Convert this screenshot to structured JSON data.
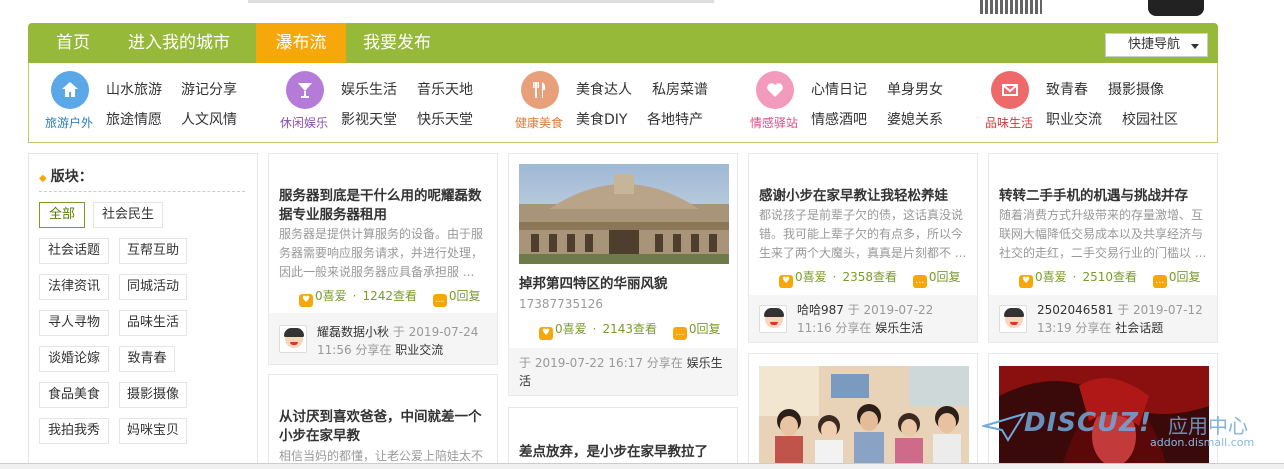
{
  "nav": {
    "items": [
      "首页",
      "进入我的城市",
      "瀑布流",
      "我要发布"
    ],
    "active_index": 2,
    "quick_nav": "快捷导航"
  },
  "categories": [
    {
      "name": "旅游户外",
      "icon": "home-icon",
      "color": "#5aa8e8",
      "name_color": "#2a7cc4",
      "links": [
        "山水旅游",
        "游记分享",
        "旅途情愿",
        "人文风情"
      ]
    },
    {
      "name": "休闲娱乐",
      "icon": "cocktail-icon",
      "color": "#b57bd9",
      "name_color": "#8b4fb3",
      "links": [
        "娱乐生活",
        "音乐天地",
        "影视天堂",
        "快乐天堂"
      ]
    },
    {
      "name": "健康美食",
      "icon": "fork-knife-icon",
      "color": "#e8a07a",
      "name_color": "#e07a3a",
      "links": [
        "美食达人",
        "私房菜谱",
        "美食DIY",
        "各地特产"
      ]
    },
    {
      "name": "情感驿站",
      "icon": "heart-icon",
      "color": "#f29bbd",
      "name_color": "#e04a8a",
      "links": [
        "心情日记",
        "单身男女",
        "情感酒吧",
        "婆媳关系"
      ]
    },
    {
      "name": "品味生活",
      "icon": "envelope-icon",
      "color": "#ee6a6a",
      "name_color": "#d13a3a",
      "links": [
        "致青春",
        "摄影摄像",
        "职业交流",
        "校园社区"
      ]
    }
  ],
  "sidebar": {
    "heading": "版块：",
    "tags": [
      "全部",
      "社会民生",
      "社会话题",
      "互帮互助",
      "法律资讯",
      "同城活动",
      "寻人寻物",
      "品味生活",
      "谈婚论嫁",
      "致青春",
      "食品美食",
      "摄影摄像",
      "我拍我秀",
      "妈咪宝贝"
    ],
    "active_tag": "全部"
  },
  "posts": [
    {
      "title": "服务器到底是干什么用的呢耀磊数据专业服务器租用",
      "summary": "服务器是提供计算服务的设备。由于服务器需要响应服务请求，并进行处理，因此一般来说服务器应具备承担服 ...",
      "likes": "0喜爱",
      "views": "1242查看",
      "replies": "0回复",
      "user": "耀磊数据小秋",
      "date": "于 2019-07-24",
      "time": "11:56 分享在",
      "board": "职业交流"
    },
    {
      "title": "从讨厌到喜欢爸爸，中间就差一个小步在家早教",
      "summary": "相信当妈的都懂，让老公爱上陪娃太不"
    },
    {
      "title": "掉邦第四特区的华丽风貌",
      "subtitle": "17387735126",
      "likes": "0喜爱",
      "views": "2143查看",
      "replies": "0回复",
      "date": "于 2019-07-22 16:17 分享在",
      "board": "娱乐生活"
    },
    {
      "title": "差点放弃，是小步在家早教拉了"
    },
    {
      "title": "感谢小步在家早教让我轻松养娃",
      "summary": "都说孩子是前辈子欠的债，这话真没说错。我可能上辈子欠的有点多，所以今生来了两个大魔头，真真是片刻都不 ...",
      "likes": "0喜爱",
      "views": "2358查看",
      "replies": "0回复",
      "user": "哈哈987",
      "date": "于 2019-07-22",
      "time": "11:16 分享在",
      "board": "娱乐生活"
    },
    {
      "title": "转转二手手机的机遇与挑战并存",
      "summary": "随着消费方式升级带来的存量激增、互联网大幅降低交易成本以及共享经济与社交的走红，二手交易行业的门槛以 ...",
      "likes": "0喜爱",
      "views": "2510查看",
      "replies": "0回复",
      "user": "2502046581",
      "date": "于 2019-07-12",
      "time": "13:19 分享在",
      "board": "社会话题"
    }
  ],
  "watermark": {
    "logo": "DISCUZ!",
    "cn": "应用中心",
    "url": "addon.dismall.com"
  }
}
